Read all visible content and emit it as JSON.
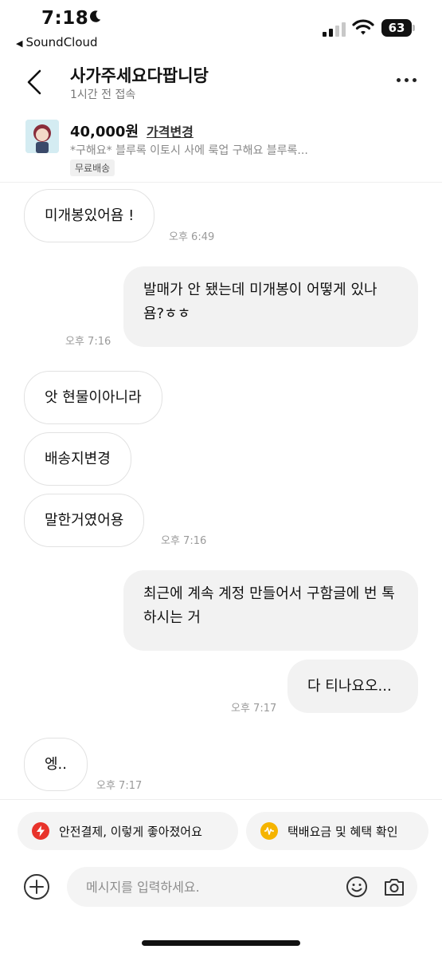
{
  "status_bar": {
    "time": "7:18",
    "back_app": "SoundCloud",
    "battery": "63"
  },
  "header": {
    "title": "사가주세요다팝니당",
    "subtitle": "1시간 전 접속"
  },
  "product": {
    "price": "40,000원",
    "price_change": "가격변경",
    "description": "*구해요* 블루록 이토시 사에 룩업 구해요 블루록...",
    "shipping_badge": "무료배송"
  },
  "messages": [
    {
      "side": "in",
      "text": "미개봉있어욤 !"
    },
    {
      "side": "out",
      "text": "발매가 안 됐는데 미개봉이 어떻게 있나 욤?ㅎㅎ"
    },
    {
      "side": "in",
      "text": "앗 현물이아니라"
    },
    {
      "side": "in",
      "text": "배송지변경"
    },
    {
      "side": "in",
      "text": "말한거였어용"
    },
    {
      "side": "out",
      "text": "최근에 계속 계정 만들어서 구함글에 번 톡하시는 거"
    },
    {
      "side": "out",
      "text": "다 티나요오..."
    },
    {
      "side": "in",
      "text": "엥.."
    }
  ],
  "timestamps": [
    "오후 6:49",
    "오후 7:16",
    "오후 7:16",
    "오후 7:17",
    "오후 7:17"
  ],
  "chips": {
    "safe_payment": "안전결제, 이렇게 좋아졌어요",
    "shipping_fee": "택배요금 및 혜택 확인"
  },
  "composer": {
    "placeholder": "메시지를 입력하세요."
  },
  "colors": {
    "safe_icon": "#e8332b",
    "shipping_icon": "#f5b400"
  },
  "icons": [
    "moon-icon",
    "signal-icon",
    "wifi-icon",
    "battery-icon",
    "back-chevron-icon",
    "more-icon",
    "plus-icon",
    "emoji-icon",
    "camera-icon",
    "lightning-icon",
    "waveform-icon"
  ]
}
